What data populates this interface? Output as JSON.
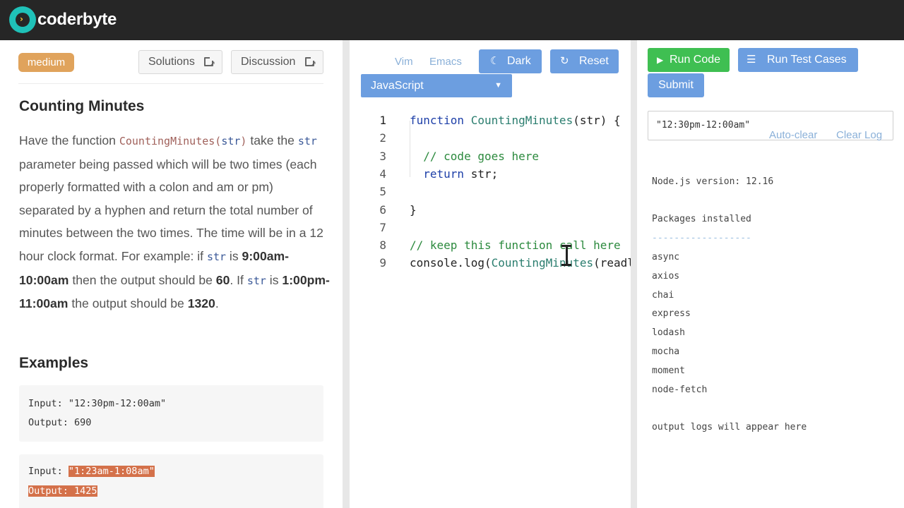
{
  "brand": {
    "name": "coderbyte"
  },
  "left": {
    "badge": "medium",
    "solutions_label": "Solutions",
    "discussion_label": "Discussion",
    "title": "Counting Minutes",
    "desc": {
      "p1": "Have the function ",
      "fn": "CountingMinutes",
      "paren_open": "(",
      "arg": "str",
      "paren_close": ")",
      "p2": " take the ",
      "arg2": "str",
      "p3": " parameter being passed which will be two times (each properly formatted with a colon and am or pm) separated by a hyphen and return the total number of minutes between the two times. The time will be in a 12 hour clock format. For example: if ",
      "arg3": "str",
      "p4": " is ",
      "ex1": "9:00am-10:00am",
      "p5": " then the output should be ",
      "ex1_out": "60",
      "p6": ". If ",
      "arg4": "str",
      "p7": " is ",
      "ex2": "1:00pm-11:00am",
      "p8": " the output should be ",
      "ex2_out": "1320",
      "p9": "."
    },
    "examples_title": "Examples",
    "examples": [
      {
        "input_label": "Input: ",
        "input_value": "\"12:30pm-12:00am\"",
        "output_label": "Output: ",
        "output_value": "690"
      },
      {
        "input_label": "Input: ",
        "input_value": "\"1:23am-1:08am\"",
        "output_label": "Output: ",
        "output_value": "1425"
      }
    ]
  },
  "editor": {
    "modes": [
      "Vim",
      "Emacs"
    ],
    "dark_label": "Dark",
    "reset_label": "Reset",
    "language": "JavaScript",
    "lines": [
      {
        "n": "1",
        "parts": [
          [
            "kw",
            "function"
          ],
          [
            "txt",
            " "
          ],
          [
            "fn",
            "CountingMinutes"
          ],
          [
            "txt",
            "(str) {"
          ]
        ]
      },
      {
        "n": "2",
        "parts": []
      },
      {
        "n": "3",
        "parts": [
          [
            "cm",
            "  // code goes here"
          ]
        ]
      },
      {
        "n": "4",
        "parts": [
          [
            "kw",
            "  return"
          ],
          [
            "txt",
            " str;"
          ]
        ]
      },
      {
        "n": "5",
        "parts": []
      },
      {
        "n": "6",
        "parts": [
          [
            "txt",
            "}"
          ]
        ]
      },
      {
        "n": "7",
        "parts": []
      },
      {
        "n": "8",
        "parts": [
          [
            "cm",
            "// keep this function call here"
          ]
        ]
      },
      {
        "n": "9",
        "parts": [
          [
            "txt",
            "console.log("
          ],
          [
            "fn",
            "CountingMinutes"
          ],
          [
            "txt",
            "(readline()));"
          ]
        ]
      }
    ]
  },
  "console": {
    "run_code_label": "Run Code",
    "run_tests_label": "Run Test Cases",
    "submit_label": "Submit",
    "log_value": "\"12:30pm-12:00am\"",
    "auto_clear_label": "Auto-clear",
    "clear_log_label": "Clear Log",
    "node_version": "Node.js version: 12.16",
    "packages_title": "Packages installed",
    "separator": "------------------",
    "packages": [
      "async",
      "axios",
      "chai",
      "express",
      "lodash",
      "mocha",
      "moment",
      "node-fetch"
    ],
    "footer": "output logs will appear here"
  }
}
